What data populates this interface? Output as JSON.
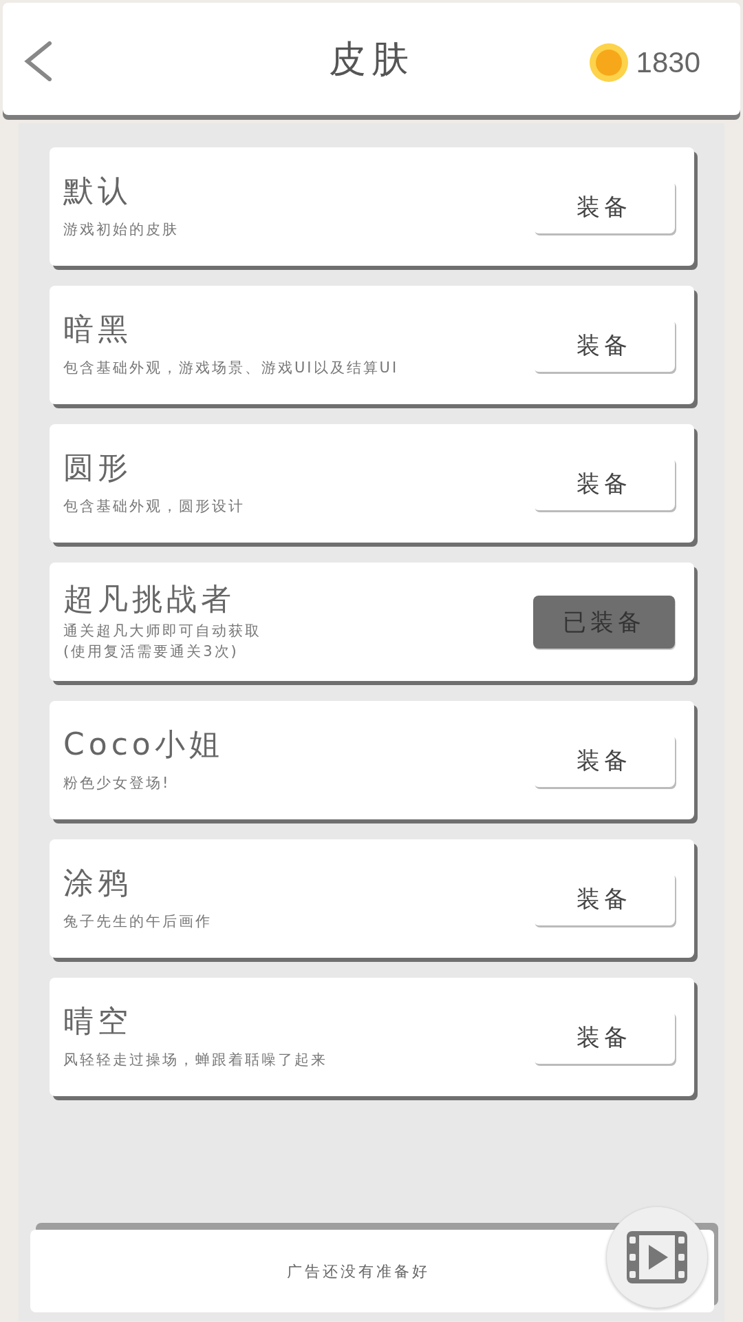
{
  "header": {
    "title": "皮肤",
    "coins": "1830"
  },
  "skins": [
    {
      "name": "默认",
      "description": "游戏初始的皮肤",
      "button": "装备",
      "equipped": false
    },
    {
      "name": "暗黑",
      "description": "包含基础外观，游戏场景、游戏UI以及结算UI",
      "button": "装备",
      "equipped": false
    },
    {
      "name": "圆形",
      "description": "包含基础外观，圆形设计",
      "button": "装备",
      "equipped": false
    },
    {
      "name": "超凡挑战者",
      "description": "通关超凡大师即可自动获取\n(使用复活需要通关3次)",
      "button": "已装备",
      "equipped": true
    },
    {
      "name": "Coco小姐",
      "description": "粉色少女登场!",
      "button": "装备",
      "equipped": false
    },
    {
      "name": "涂鸦",
      "description": "兔子先生的午后画作",
      "button": "装备",
      "equipped": false
    },
    {
      "name": "晴空",
      "description": "风轻轻走过操场，蝉跟着聒噪了起来",
      "button": "装备",
      "equipped": false
    }
  ],
  "ad_banner": {
    "message": "广告还没有准备好"
  }
}
